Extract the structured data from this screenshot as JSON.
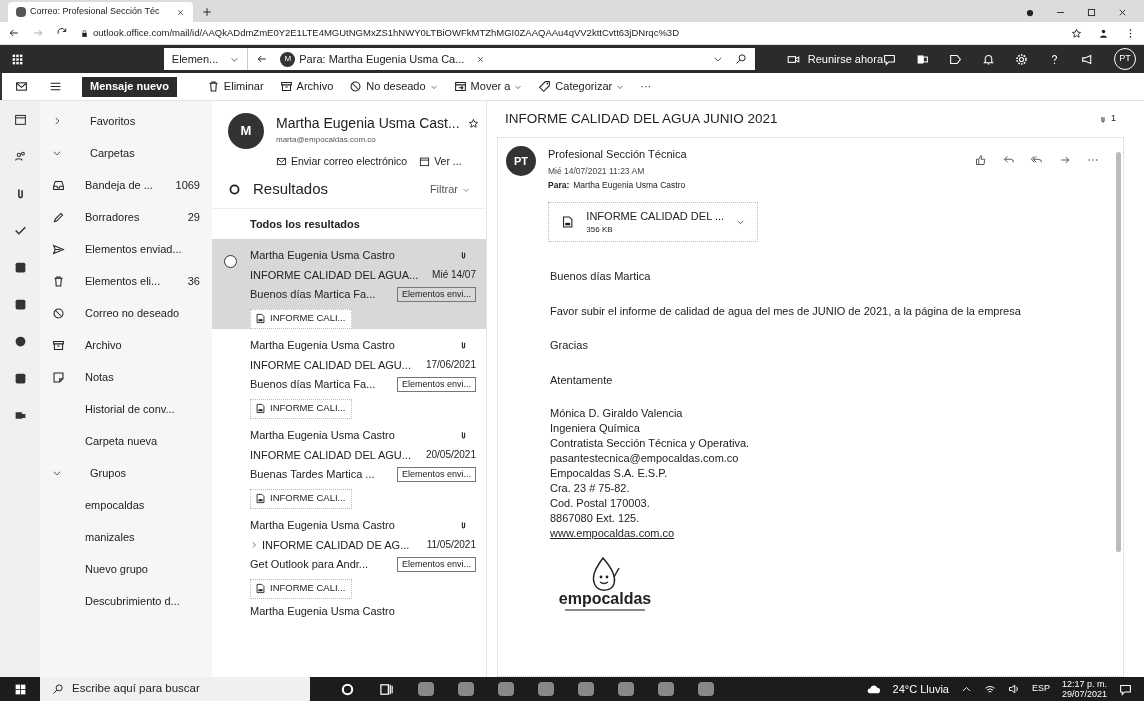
{
  "browser": {
    "tab_title": "Correo: Profesional Sección Téc",
    "url": "outlook.office.com/mail/id/AAQkADdmZmE0Y2E1LTE4MGUtNGMxZS1hNWY0LTBiOWFkMTZhMGI0ZAAQAAu4qVV2kttCvtt63jDNrqc%3D"
  },
  "header": {
    "search_scope": "Elemen...",
    "search_chip_initial": "M",
    "search_chip": "Para: Martha Eugenia Usma Ca...",
    "meet": "Reunirse ahora",
    "avatar": "PT"
  },
  "toolbar": {
    "new_message": "Mensaje nuevo",
    "actions": [
      {
        "label": "Eliminar",
        "menu": false
      },
      {
        "label": "Archivo",
        "menu": false
      },
      {
        "label": "No deseado",
        "menu": true
      },
      {
        "label": "Mover a",
        "menu": true
      },
      {
        "label": "Categorizar",
        "menu": true
      }
    ],
    "more": "···"
  },
  "folders": [
    {
      "kind": "section",
      "label": "Favoritos",
      "expanded": false
    },
    {
      "kind": "section",
      "label": "Carpetas",
      "expanded": true
    },
    {
      "kind": "folder",
      "label": "Bandeja de ...",
      "count": "1069"
    },
    {
      "kind": "folder",
      "label": "Borradores",
      "count": "29"
    },
    {
      "kind": "folder",
      "label": "Elementos enviad..."
    },
    {
      "kind": "folder",
      "label": "Elementos eli...",
      "count": "36"
    },
    {
      "kind": "folder",
      "label": "Correo no deseado"
    },
    {
      "kind": "folder",
      "label": "Archivo"
    },
    {
      "kind": "folder",
      "label": "Notas"
    },
    {
      "kind": "folder",
      "label": "Historial de conv..."
    },
    {
      "kind": "folder",
      "label": "Carpeta nueva"
    },
    {
      "kind": "section",
      "label": "Grupos",
      "expanded": true
    },
    {
      "kind": "folder",
      "label": "empocaldas"
    },
    {
      "kind": "folder",
      "label": "manizales"
    },
    {
      "kind": "folder",
      "label": "Nuevo grupo"
    },
    {
      "kind": "folder",
      "label": "Descubrimiento d..."
    }
  ],
  "contact": {
    "initial": "M",
    "name": "Martha Eugenia Usma Cast...",
    "email": "marta@empocaldas.com.co",
    "send": "Enviar correo electrónico",
    "view": "Ver ..."
  },
  "results": {
    "title": "Resultados",
    "filter": "Filtrar",
    "section": "Todos los resultados",
    "messages": [
      {
        "sender": "Martha Eugenia Usma Castro",
        "subject": "INFORME CALIDAD DEL AGUA...",
        "date": "Mié 14/07",
        "preview": "Buenos días Martica Fa...",
        "folder": "Elementos envi...",
        "attachment": "INFORME CALI...",
        "selected": true,
        "thread": false
      },
      {
        "sender": "Martha Eugenia Usma Castro",
        "subject": "INFORME CALIDAD DEL AGU...",
        "date": "17/06/2021",
        "preview": "Buenos días Martica Fa...",
        "folder": "Elementos envi...",
        "attachment": "INFORME CALI...",
        "selected": false,
        "thread": false
      },
      {
        "sender": "Martha Eugenia Usma Castro",
        "subject": "INFORME CALIDAD DEL AGU...",
        "date": "20/05/2021",
        "preview": "Buenas Tardes Martica ...",
        "folder": "Elementos envi...",
        "attachment": "INFORME CALI...",
        "selected": false,
        "thread": false
      },
      {
        "sender": "Martha Eugenia Usma Castro",
        "subject": "INFORME CALIDAD DE AG...",
        "date": "11/05/2021",
        "preview": "Get Outlook para Andr...",
        "folder": "Elementos envi...",
        "attachment": "INFORME CALI...",
        "selected": false,
        "thread": true
      },
      {
        "sender": "Martha Eugenia Usma Castro"
      }
    ]
  },
  "reading": {
    "subject": "INFORME CALIDAD DEL AGUA JUNIO 2021",
    "attachment_count": "1",
    "initials": "PT",
    "sender": "Profesional Sección Técnica",
    "date": "Mié 14/07/2021 11:23 AM",
    "to_label": "Para:",
    "to": "Martha Eugenia Usma Castro",
    "file": {
      "name": "INFORME CALIDAD DEL ...",
      "size": "356 KB"
    },
    "body": [
      "Buenos días Martica",
      "Favor subir el informe de calidad de agua del mes de JUNIO de 2021, a la página de la empresa",
      "Gracias",
      "Atentamente"
    ],
    "signature": [
      "Mónica D. Giraldo Valencia",
      "Ingeniera Química",
      "Contratista Sección Técnica y Operativa.",
      "pasantestecnica@empocaldas.com.co",
      "Empocaldas S.A. E.S.P.",
      "Cra. 23 # 75-82.",
      "Cod. Postal 170003.",
      "8867080 Ext. 125."
    ],
    "link": "www.empocaldas.com.co",
    "logo": "empocaldas"
  },
  "taskbar": {
    "search": "Escribe aquí para buscar",
    "weather": "24°C Lluvia",
    "language": "ESP",
    "time": "12:17 p. m.",
    "date": "29/07/2021"
  }
}
